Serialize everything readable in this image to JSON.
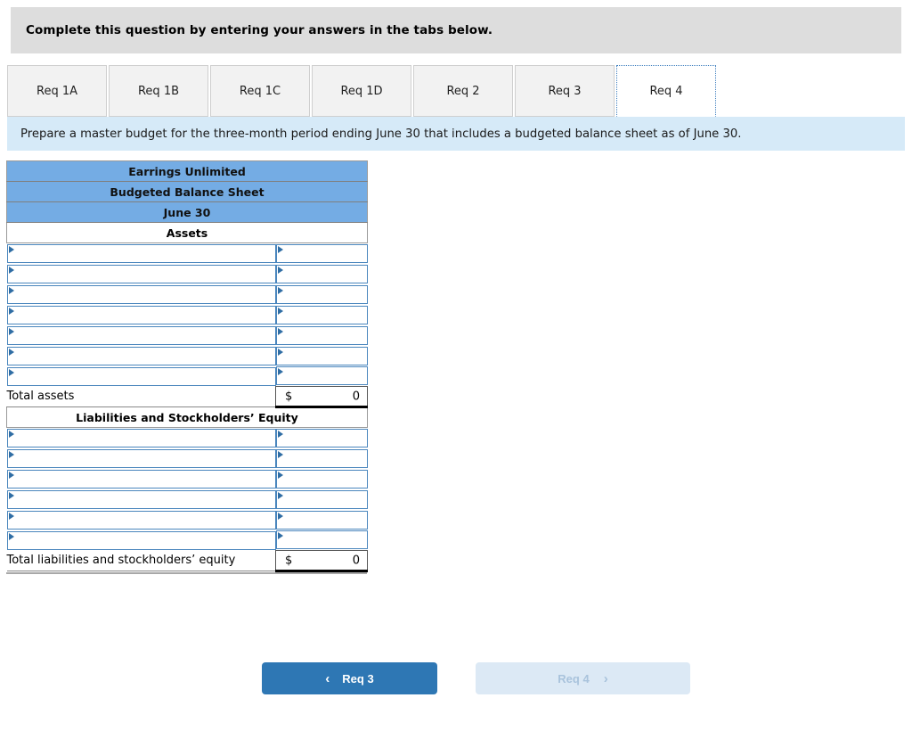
{
  "header": {
    "instruction": "Complete this question by entering your answers in the tabs below."
  },
  "tabs": {
    "items": [
      {
        "label": "Req 1A",
        "active": false
      },
      {
        "label": "Req 1B",
        "active": false
      },
      {
        "label": "Req 1C",
        "active": false
      },
      {
        "label": "Req 1D",
        "active": false
      },
      {
        "label": "Req 2",
        "active": false
      },
      {
        "label": "Req 3",
        "active": false
      },
      {
        "label": "Req 4",
        "active": true
      }
    ]
  },
  "requirement": {
    "text": "Prepare a master budget for the three-month period ending June 30 that includes a budgeted balance sheet as of June 30."
  },
  "balance_sheet": {
    "company": "Earrings Unlimited",
    "statement": "Budgeted Balance Sheet",
    "date": "June 30",
    "assets_section_title": "Assets",
    "assets_rows": 7,
    "assets_total_label": "Total assets",
    "assets_total_currency": "$",
    "assets_total_value": "0",
    "liabilities_section_title": "Liabilities and Stockholders’ Equity",
    "liabilities_rows": 6,
    "liabilities_total_label": "Total liabilities and stockholders’ equity",
    "liabilities_total_currency": "$",
    "liabilities_total_value": "0",
    "header_color": "#74ace4",
    "field_border_color": "#4a86bd"
  },
  "navigation": {
    "prev_label": "Req 3",
    "prev_icon": "chevron-left-icon",
    "prev_chevron": "‹",
    "next_label": "Req 4",
    "next_icon": "chevron-right-icon",
    "next_chevron": "›",
    "prev_color": "#2e77b4",
    "next_color": "#dce9f5",
    "next_disabled": true
  }
}
